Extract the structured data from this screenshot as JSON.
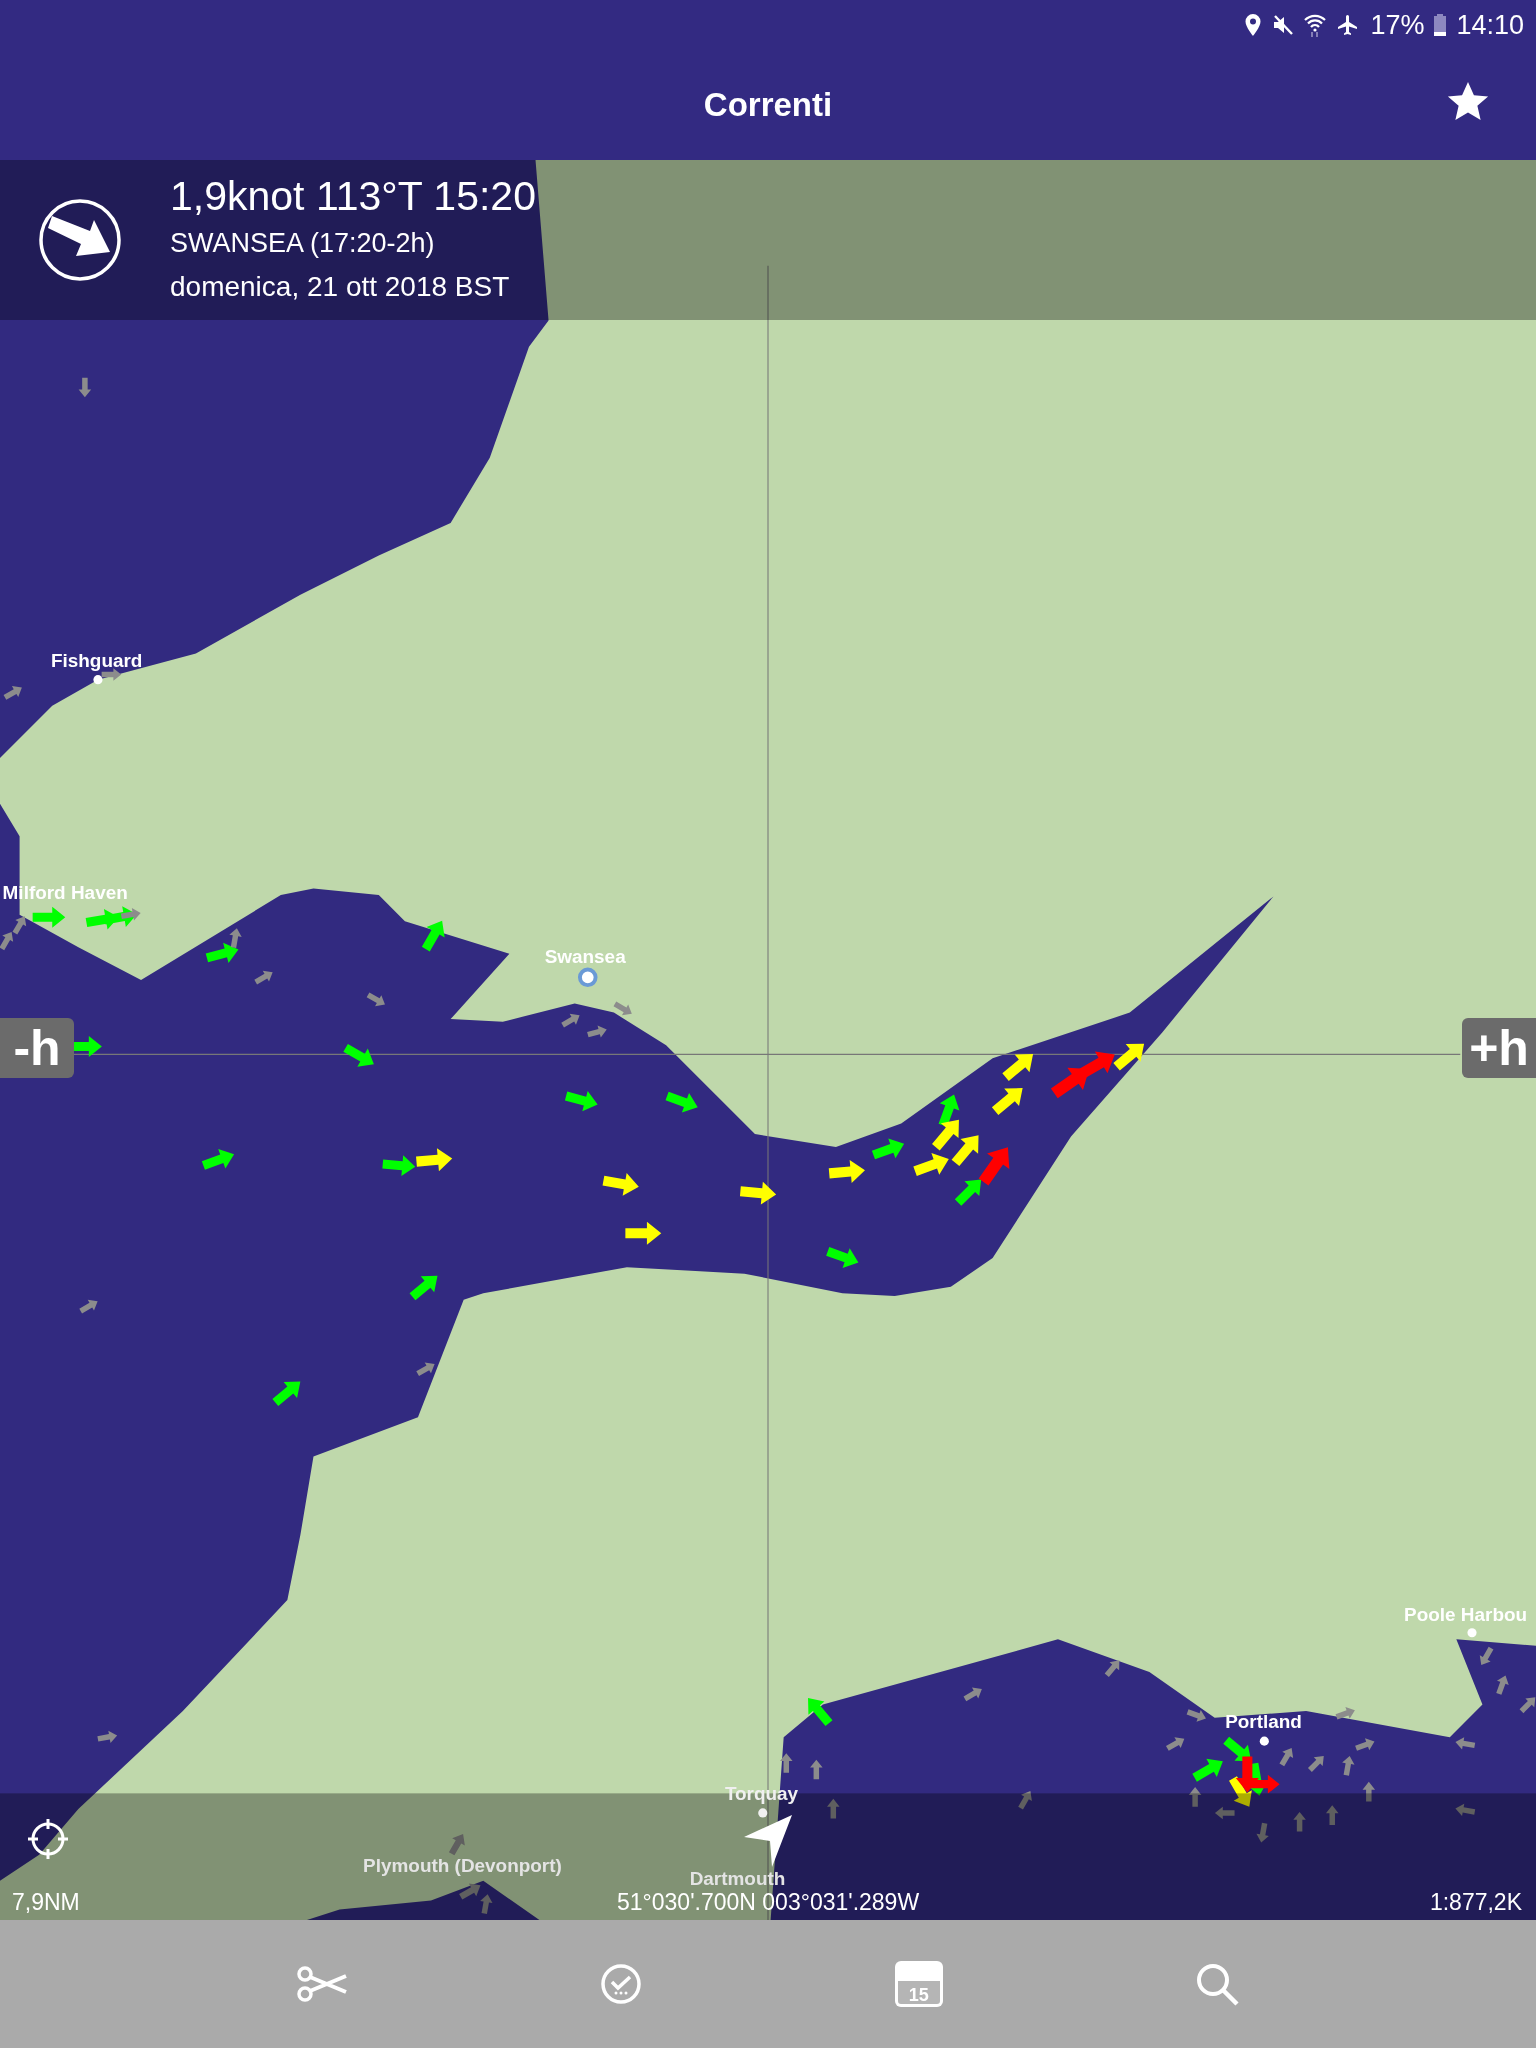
{
  "status_bar": {
    "battery": "17%",
    "time": "14:10"
  },
  "app_bar": {
    "title": "Correnti"
  },
  "current_info": {
    "reading": "1,9knot 113°T 15:20",
    "station": "SWANSEA (17:20-2h)",
    "date": "domenica, 21 ott 2018 BST"
  },
  "time_buttons": [
    "-h",
    "+h"
  ],
  "places": [
    "Fishguard",
    "Milford Haven",
    "Swansea",
    "Torquay",
    "Plymouth (Devonport)",
    "Dartmouth",
    "Portland",
    "Poole Harbou"
  ],
  "map_footer": {
    "distance": "7,9NM",
    "position": "51°030'.700N 003°031'.289W",
    "scale": "1:877,2K"
  },
  "bottom_nav": {
    "calendar_day": "15"
  }
}
